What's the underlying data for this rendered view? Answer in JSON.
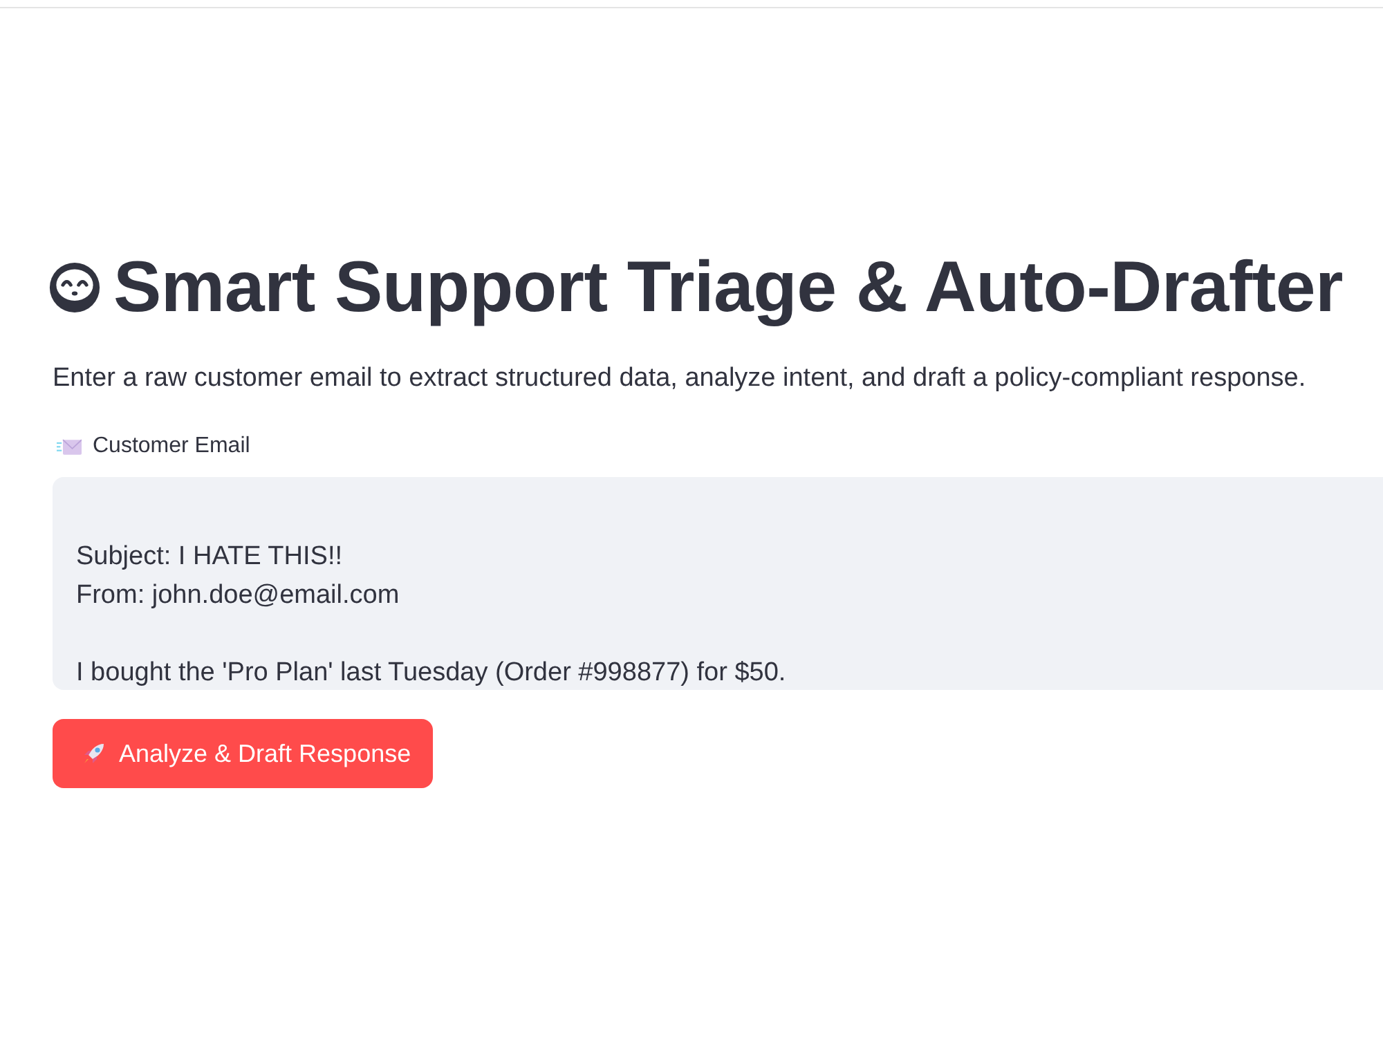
{
  "title": "Smart Support Triage & Auto-Drafter",
  "description": "Enter a raw customer email to extract structured data, analyze intent, and draft a policy-compliant response.",
  "email_field": {
    "label": "Customer Email",
    "value": "\nSubject: I HATE THIS!!\nFrom: john.doe@email.com\n\nI bought the 'Pro Plan' last Tuesday (Order #998877) for $50."
  },
  "submit_button": {
    "label": "Analyze & Draft Response"
  }
}
